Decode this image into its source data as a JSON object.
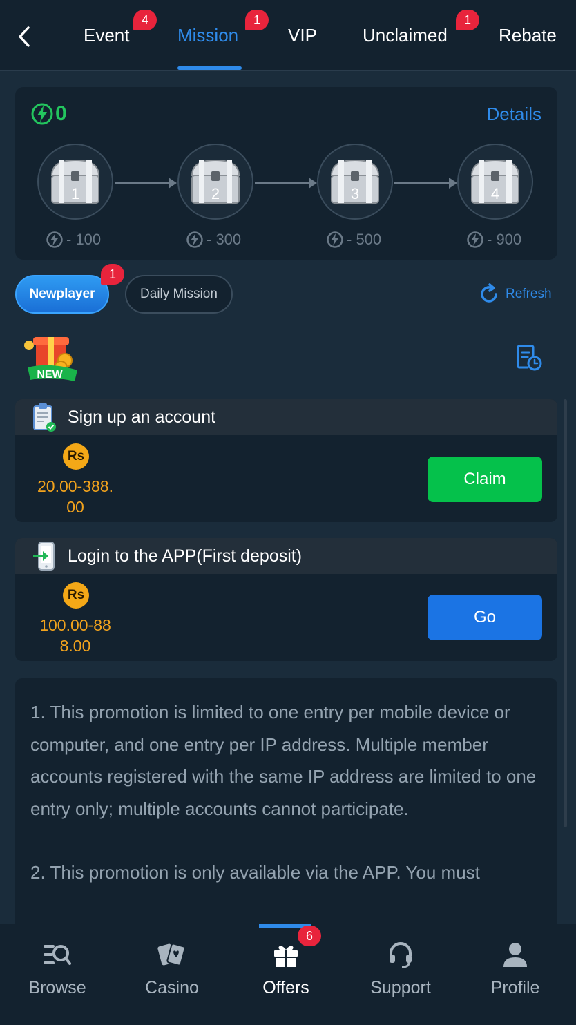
{
  "header": {
    "tabs": [
      {
        "label": "Event",
        "badge": "4"
      },
      {
        "label": "Mission",
        "badge": "1",
        "active": true
      },
      {
        "label": "VIP"
      },
      {
        "label": "Unclaimed",
        "badge": "1"
      },
      {
        "label": "Rebate"
      }
    ]
  },
  "progress": {
    "energy": "0",
    "details_label": "Details",
    "chests": [
      {
        "number": "1",
        "cost": "- 100"
      },
      {
        "number": "2",
        "cost": "- 300"
      },
      {
        "number": "3",
        "cost": "- 500"
      },
      {
        "number": "4",
        "cost": "- 900"
      }
    ]
  },
  "filters": {
    "newplayer_label": "Newplayer",
    "newplayer_badge": "1",
    "daily_label": "Daily Mission",
    "refresh_label": "Refresh"
  },
  "new_badge": "NEW",
  "missions": [
    {
      "title": "Sign up an account",
      "currency": "Rs",
      "reward_line1": "20.00-388.",
      "reward_line2": "00",
      "action": "Claim"
    },
    {
      "title": "Login to the APP(First deposit)",
      "currency": "Rs",
      "reward_line1": "100.00-88",
      "reward_line2": "8.00",
      "action": "Go"
    }
  ],
  "rules": {
    "p1": "1. This promotion is limited to one entry per mobile device or computer, and one entry per IP address. Multiple member accounts registered with the same IP address are limited to one entry only; multiple accounts cannot participate.",
    "p2": "2. This promotion is only available via the APP. You must"
  },
  "bottom_nav": {
    "items": [
      {
        "label": "Browse",
        "icon": "browse-icon"
      },
      {
        "label": "Casino",
        "icon": "cards-icon"
      },
      {
        "label": "Offers",
        "icon": "gift-icon",
        "badge": "6",
        "active": true
      },
      {
        "label": "Support",
        "icon": "headset-icon"
      },
      {
        "label": "Profile",
        "icon": "person-icon"
      }
    ]
  },
  "colors": {
    "accent": "#2f8bea",
    "claim": "#05c14b",
    "go": "#1b74e4",
    "badge": "#e8243c",
    "reward": "#f2a31d",
    "energy": "#23c55e"
  }
}
